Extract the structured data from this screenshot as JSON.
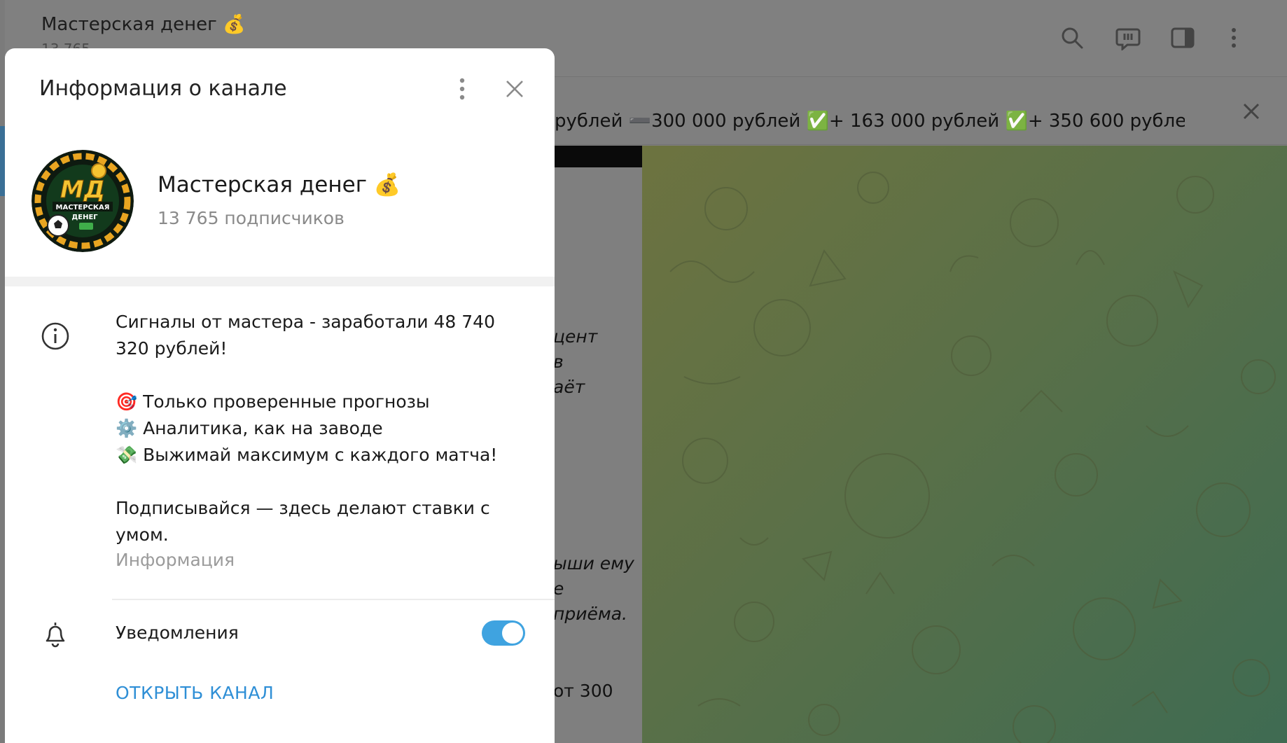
{
  "background": {
    "chat_title": "Мастерская денег 💰",
    "chat_subtitle": "13 765",
    "pinned_text": "рублей ➖300 000 рублей ✅+ 163 000 рублей ✅+ 350 600 рублей ...",
    "message_fragments": [
      "цент",
      "в",
      "аёт",
      "ыши ему",
      "е",
      "приёма.",
      "от 300"
    ]
  },
  "modal": {
    "title": "Информация о канале",
    "channel_name": "Мастерская денег",
    "channel_emoji": "💰",
    "subscribers": "13 765 подписчиков",
    "avatar_text_top": "МД",
    "avatar_text_mid": "МАСТЕРСКАЯ",
    "avatar_text_bot": "ДЕНЕГ",
    "description": {
      "line1": "Сигналы от мастера - заработали 48 740 320 рублей!",
      "bullet1_emoji": "🎯",
      "bullet1": "Только проверенные прогнозы",
      "bullet2_emoji": "⚙️",
      "bullet2": "Аналитика, как на заводе",
      "bullet3_emoji": "💸",
      "bullet3": "Выжимай максимум с каждого матча!",
      "closing": "Подписывайся — здесь делают ставки с умом."
    },
    "info_label": "Информация",
    "notifications_label": "Уведомления",
    "notifications_on": true,
    "open_channel": "ОТКРЫТЬ КАНАЛ"
  },
  "colors": {
    "accent": "#3fa3e0",
    "link": "#2f8fd6"
  }
}
